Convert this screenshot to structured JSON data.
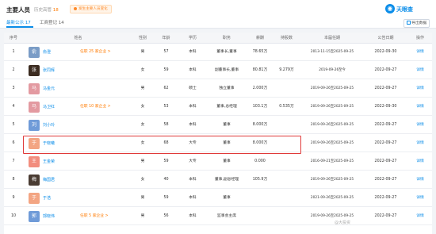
{
  "header": {
    "title": "主要人员",
    "history_label": "历史高管",
    "history_count": "18",
    "badge_label": "发生主要人员变化",
    "logo_text": "天眼查"
  },
  "tabs": [
    {
      "label": "最新公示",
      "count": "17",
      "active": true
    },
    {
      "label": "工商登记",
      "count": "14",
      "active": false
    }
  ],
  "export_label": "导出数据",
  "columns": [
    "序号",
    "姓名",
    "性别",
    "年龄",
    "学历",
    "职务",
    "薪酬",
    "持股数",
    "本届任期",
    "公告日期",
    "操作"
  ],
  "rows": [
    {
      "idx": "1",
      "name": "俞澄",
      "avatar_text": "俞",
      "avatar_color": "#7a9cc6",
      "tag": "任职 25 家企业 >",
      "gender": "男",
      "age": "57",
      "edu": "本科",
      "title": "董事长,董事",
      "pay": "78.65万",
      "shares": "",
      "term": "2013-11-15至2025-09-25",
      "date": "2022-09-30",
      "op": "详情"
    },
    {
      "idx": "2",
      "name": "张同辉",
      "avatar_text": "张",
      "avatar_color": "#3b2b20",
      "tag": "",
      "gender": "女",
      "age": "59",
      "edu": "本科",
      "title": "副董事长,董事",
      "pay": "80.81万",
      "shares": "9.279万",
      "term": "2019-09-26至今",
      "date": "2022-09-27",
      "op": "详情"
    },
    {
      "idx": "3",
      "name": "马金元",
      "avatar_text": "马",
      "avatar_color": "#e39aa1",
      "tag": "",
      "gender": "男",
      "age": "62",
      "edu": "硕士",
      "title": "独立董事",
      "pay": "2.000万",
      "shares": "",
      "term": "2019-09-26至2025-09-25",
      "date": "2022-09-27",
      "op": "详情"
    },
    {
      "idx": "4",
      "name": "马卫红",
      "avatar_text": "马",
      "avatar_color": "#e39aa1",
      "tag": "任职 10 家企业 >",
      "gender": "女",
      "age": "53",
      "edu": "本科",
      "title": "董事,总经理",
      "pay": "103.1万",
      "shares": "0.535万",
      "term": "2019-09-26至2025-09-25",
      "date": "2022-09-30",
      "op": "详情"
    },
    {
      "idx": "5",
      "name": "刘小玲",
      "avatar_text": "刘",
      "avatar_color": "#6f9bd8",
      "tag": "",
      "gender": "女",
      "age": "58",
      "edu": "本科",
      "title": "董事",
      "pay": "8.000万",
      "shares": "",
      "term": "2019-09-26至2025-09-25",
      "date": "2022-09-27",
      "op": "详情"
    },
    {
      "idx": "6",
      "name": "于晓曦",
      "avatar_text": "于",
      "avatar_color": "#f3a583",
      "tag": "",
      "gender": "女",
      "age": "68",
      "edu": "大专",
      "title": "董事",
      "pay": "8.000万",
      "shares": "",
      "term": "2019-09-26至2025-09-25",
      "date": "2022-09-27",
      "op": "详情"
    },
    {
      "idx": "7",
      "name": "王金荣",
      "avatar_text": "王",
      "avatar_color": "#f28d7e",
      "tag": "",
      "gender": "男",
      "age": "59",
      "edu": "大专",
      "title": "董事",
      "pay": "0.000",
      "shares": "",
      "term": "2016-09-21至2025-09-25",
      "date": "2022-09-27",
      "op": "详情"
    },
    {
      "idx": "8",
      "name": "梅国君",
      "avatar_text": "梅",
      "avatar_color": "#4a3c33",
      "tag": "",
      "gender": "女",
      "age": "40",
      "edu": "本科",
      "title": "董事,副总经理",
      "pay": "105.9万",
      "shares": "",
      "term": "2019-09-26至2025-09-25",
      "date": "2022-09-27",
      "op": "详情"
    },
    {
      "idx": "9",
      "name": "于浩",
      "avatar_text": "于",
      "avatar_color": "#f3a583",
      "tag": "",
      "gender": "男",
      "age": "59",
      "edu": "本科",
      "title": "董事",
      "pay": "",
      "shares": "",
      "term": "2021-09-26至2025-09-25",
      "date": "2022-09-27",
      "op": "详情"
    },
    {
      "idx": "10",
      "name": "郭晓伟",
      "avatar_text": "郭",
      "avatar_color": "#6f9bd8",
      "tag": "任职 5 家企业 >",
      "gender": "男",
      "age": "56",
      "edu": "本科",
      "title": "监事会主席",
      "pay": "",
      "shares": "",
      "term": "2019-09-26至2025-09-25",
      "date": "2022-09-27",
      "op": "详情"
    }
  ],
  "watermark": "@大投资"
}
